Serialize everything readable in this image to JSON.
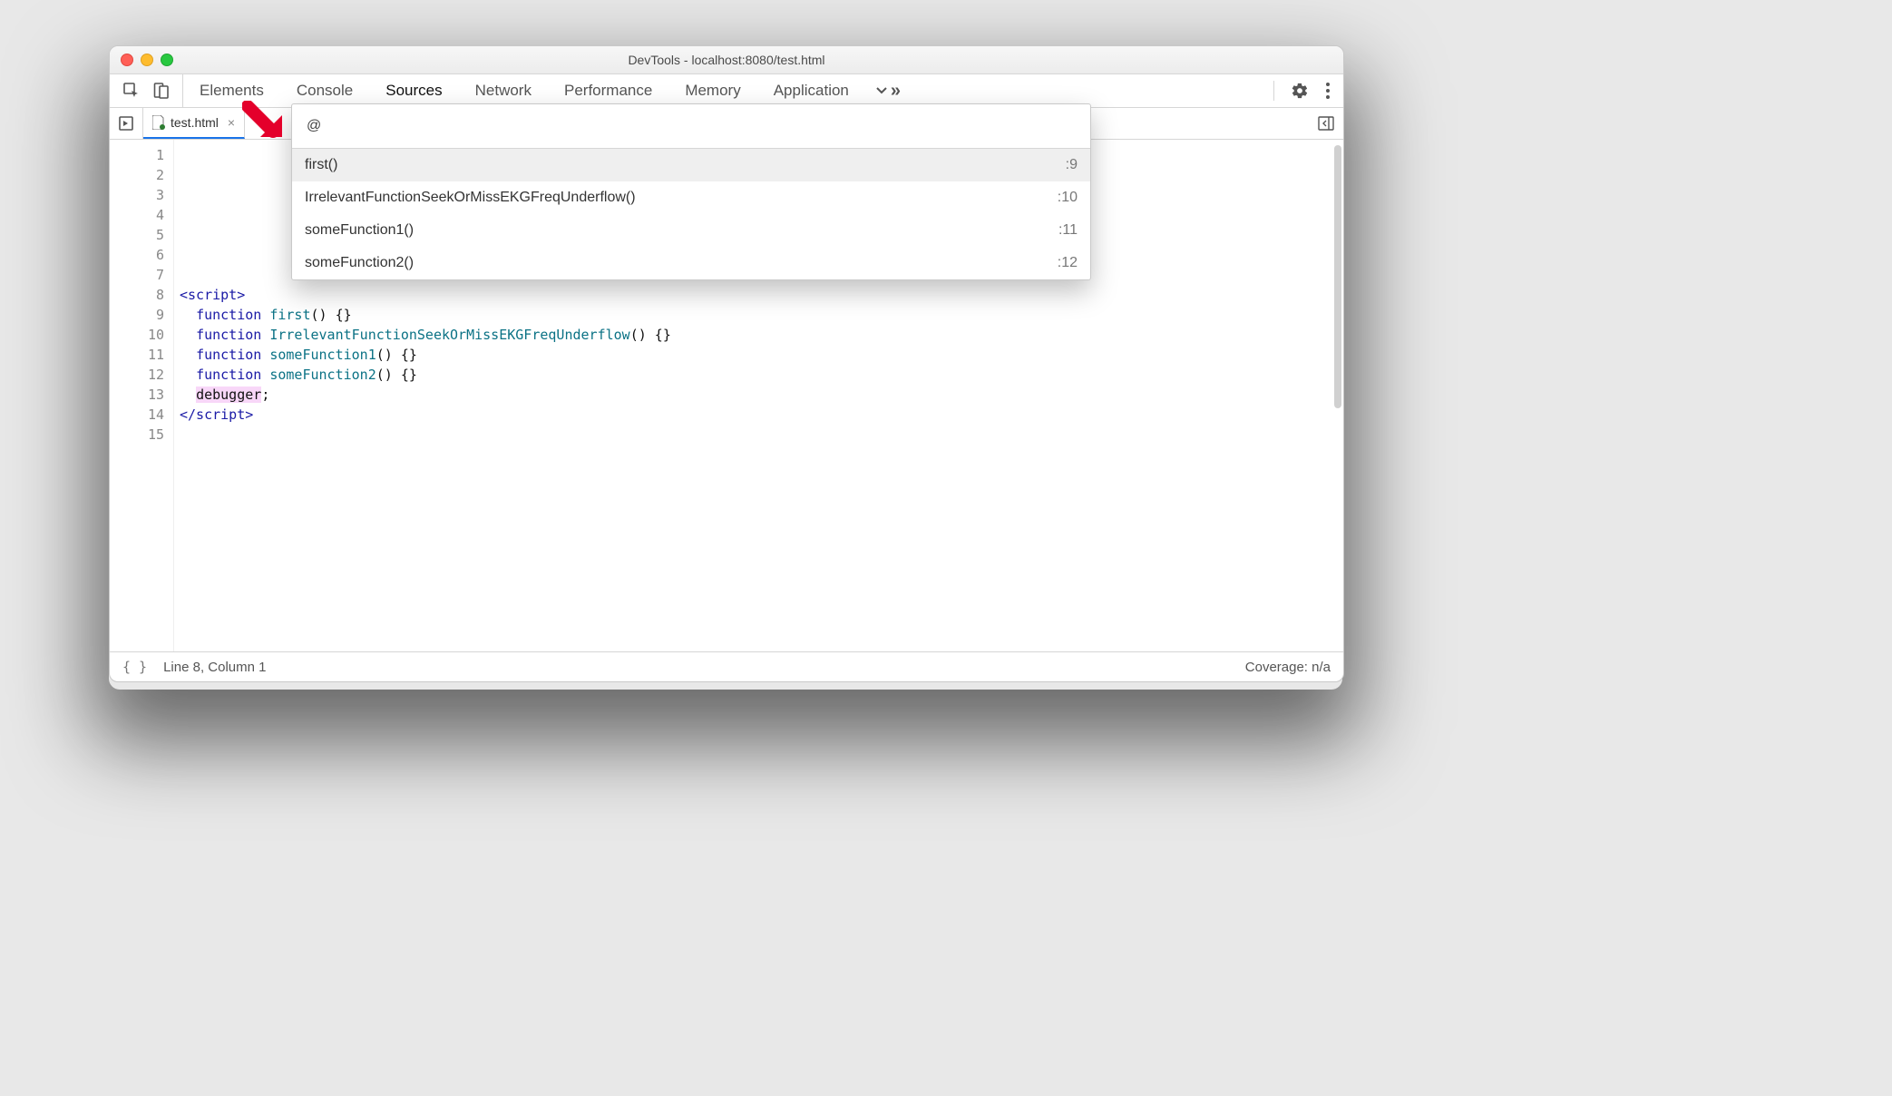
{
  "window": {
    "title": "DevTools - localhost:8080/test.html"
  },
  "tabs": {
    "items": [
      "Elements",
      "Console",
      "Sources",
      "Network",
      "Performance",
      "Memory",
      "Application"
    ],
    "active": "Sources"
  },
  "file_tab": {
    "name": "test.html"
  },
  "quickopen": {
    "query": "@",
    "rows": [
      {
        "label": "first()",
        "line": ":9"
      },
      {
        "label": "IrrelevantFunctionSeekOrMissEKGFreqUnderflow()",
        "line": ":10"
      },
      {
        "label": "someFunction1()",
        "line": ":11"
      },
      {
        "label": "someFunction2()",
        "line": ":12"
      }
    ],
    "selected": 0
  },
  "code": {
    "line_count": 15,
    "lines": [
      {
        "n": 1,
        "text": ""
      },
      {
        "n": 2,
        "text": ""
      },
      {
        "n": 3,
        "text": ""
      },
      {
        "n": 4,
        "text": ""
      },
      {
        "n": 5,
        "text": ""
      },
      {
        "n": 6,
        "text": ""
      },
      {
        "n": 7,
        "text": ""
      },
      {
        "n": 8,
        "tokens": [
          {
            "t": "<script>",
            "c": "tag"
          }
        ]
      },
      {
        "n": 9,
        "tokens": [
          {
            "t": "  "
          },
          {
            "t": "function",
            "c": "kw"
          },
          {
            "t": " "
          },
          {
            "t": "first",
            "c": "fn"
          },
          {
            "t": "() {}",
            "c": "pn"
          }
        ]
      },
      {
        "n": 10,
        "tokens": [
          {
            "t": "  "
          },
          {
            "t": "function",
            "c": "kw"
          },
          {
            "t": " "
          },
          {
            "t": "IrrelevantFunctionSeekOrMissEKGFreqUnderflow",
            "c": "fn"
          },
          {
            "t": "() {}",
            "c": "pn"
          }
        ]
      },
      {
        "n": 11,
        "tokens": [
          {
            "t": "  "
          },
          {
            "t": "function",
            "c": "kw"
          },
          {
            "t": " "
          },
          {
            "t": "someFunction1",
            "c": "fn"
          },
          {
            "t": "() {}",
            "c": "pn"
          }
        ]
      },
      {
        "n": 12,
        "tokens": [
          {
            "t": "  "
          },
          {
            "t": "function",
            "c": "kw"
          },
          {
            "t": " "
          },
          {
            "t": "someFunction2",
            "c": "fn"
          },
          {
            "t": "() {}",
            "c": "pn"
          }
        ]
      },
      {
        "n": 13,
        "tokens": [
          {
            "t": "  "
          },
          {
            "t": "debugger",
            "c": "dbg"
          },
          {
            "t": ";"
          }
        ]
      },
      {
        "n": 14,
        "tokens": [
          {
            "t": "</script>",
            "c": "tag"
          }
        ]
      },
      {
        "n": 15,
        "text": ""
      }
    ]
  },
  "status": {
    "position": "Line 8, Column 1",
    "coverage": "Coverage: n/a"
  }
}
